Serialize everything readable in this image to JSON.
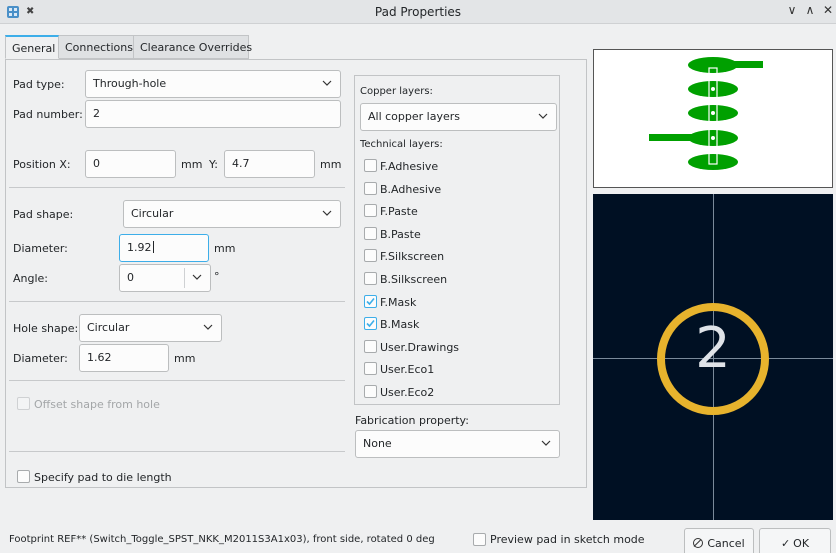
{
  "window": {
    "title": "Pad Properties"
  },
  "tabs": [
    {
      "label": "General"
    },
    {
      "label": "Connections"
    },
    {
      "label": "Clearance Overrides"
    }
  ],
  "pad": {
    "type_label": "Pad type:",
    "type_value": "Through-hole",
    "number_label": "Pad number:",
    "number_value": "2",
    "position_x_label": "Position X:",
    "position_x_value": "0",
    "position_x_unit": "mm",
    "position_y_label": "Y:",
    "position_y_value": "4.7",
    "position_y_unit": "mm",
    "shape_label": "Pad shape:",
    "shape_value": "Circular",
    "diameter_label": "Diameter:",
    "diameter_value": "1.92",
    "diameter_unit": "mm",
    "angle_label": "Angle:",
    "angle_value": "0",
    "angle_unit": "°"
  },
  "hole": {
    "shape_label": "Hole shape:",
    "shape_value": "Circular",
    "diameter_label": "Diameter:",
    "diameter_value": "1.62",
    "diameter_unit": "mm"
  },
  "options": {
    "offset_shape_label": "Offset shape from hole",
    "die_length_label": "Specify pad to die length"
  },
  "layers": {
    "copper_label": "Copper layers:",
    "copper_value": "All copper layers",
    "technical_label": "Technical layers:",
    "technical": [
      {
        "name": "F.Adhesive",
        "checked": false
      },
      {
        "name": "B.Adhesive",
        "checked": false
      },
      {
        "name": "F.Paste",
        "checked": false
      },
      {
        "name": "B.Paste",
        "checked": false
      },
      {
        "name": "F.Silkscreen",
        "checked": false
      },
      {
        "name": "B.Silkscreen",
        "checked": false
      },
      {
        "name": "F.Mask",
        "checked": true
      },
      {
        "name": "B.Mask",
        "checked": true
      },
      {
        "name": "User.Drawings",
        "checked": false
      },
      {
        "name": "User.Eco1",
        "checked": false
      },
      {
        "name": "User.Eco2",
        "checked": false
      }
    ]
  },
  "fabrication": {
    "label": "Fabrication property:",
    "value": "None"
  },
  "preview": {
    "pad_number": "2",
    "ring_color": "#e7b32d",
    "background_color": "#001023",
    "footprint_color": "#00a000"
  },
  "footer": {
    "info": "Footprint REF** (Switch_Toggle_SPST_NKK_M2011S3A1x03), front side, rotated 0 deg",
    "sketch_label": "Preview pad in sketch mode",
    "cancel_label": "Cancel",
    "ok_label": "OK"
  }
}
